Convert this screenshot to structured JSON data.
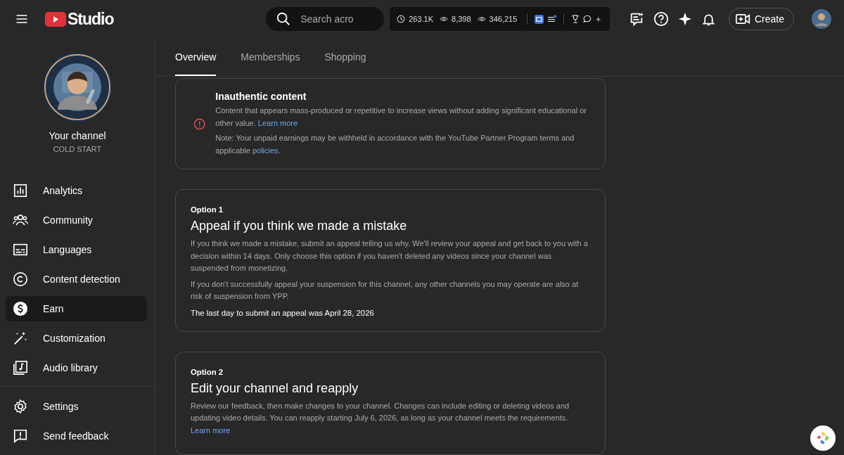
{
  "topbar": {
    "logo": "Studio",
    "search": {
      "placeholder": "Search acro"
    },
    "stats": [
      {
        "kind": "clock",
        "value": "263.1K"
      },
      {
        "kind": "eye",
        "value": "8,398"
      },
      {
        "kind": "eye",
        "value": "346,215"
      }
    ],
    "create": "Create"
  },
  "channel": {
    "title": "Your channel",
    "name": "COLD START"
  },
  "sidebar": {
    "items": [
      {
        "kind": "analytics",
        "label": "Analytics",
        "selected": false
      },
      {
        "kind": "community",
        "label": "Community",
        "selected": false
      },
      {
        "kind": "languages",
        "label": "Languages",
        "selected": false
      },
      {
        "kind": "detection",
        "label": "Content detection",
        "selected": false
      },
      {
        "kind": "earn",
        "label": "Earn",
        "selected": true
      },
      {
        "kind": "custom",
        "label": "Customization",
        "selected": false
      },
      {
        "kind": "audio",
        "label": "Audio library",
        "selected": false
      }
    ],
    "footer": [
      {
        "kind": "settings",
        "label": "Settings"
      },
      {
        "kind": "feedback",
        "label": "Send feedback"
      }
    ]
  },
  "tabs": [
    {
      "label": "Overview",
      "selected": true
    },
    {
      "label": "Memberships",
      "selected": false
    },
    {
      "label": "Shopping",
      "selected": false
    }
  ],
  "policy": {
    "title": "Inauthentic content",
    "paragraphs": [
      {
        "text": "Content that appears mass-produced or repetitive to increase views without adding significant educational or other value.",
        "link": "Learn more"
      },
      {
        "text": "Note: Your unpaid earnings may be withheld in accordance with the YouTube Partner Program terms and applicable",
        "link": "policies",
        "after": "."
      }
    ]
  },
  "options": [
    {
      "label": "Option 1",
      "title": "Appeal if you think we made a mistake",
      "paragraphs": [
        {
          "text": "If you think we made a mistake, submit an appeal telling us why. We'll review your appeal and get back to you with a decision within 14 days. Only choose this option if you haven't deleted any videos since your channel was suspended from monetizing."
        },
        {
          "text": "If you don't successfully appeal your suspension for this channel, any other channels you may operate are also at risk of suspension from YPP."
        }
      ],
      "note": "The last day to submit an appeal was April 28, 2026"
    },
    {
      "label": "Option 2",
      "title": "Edit your channel and reapply",
      "paragraphs": [
        {
          "text": "Review our feedback, then make changes to your channel. Changes can include editing or deleting videos and updating video details. You can reapply starting July 6, 2026, as long as your channel meets the requirements.",
          "link": "Learn more"
        }
      ]
    }
  ]
}
